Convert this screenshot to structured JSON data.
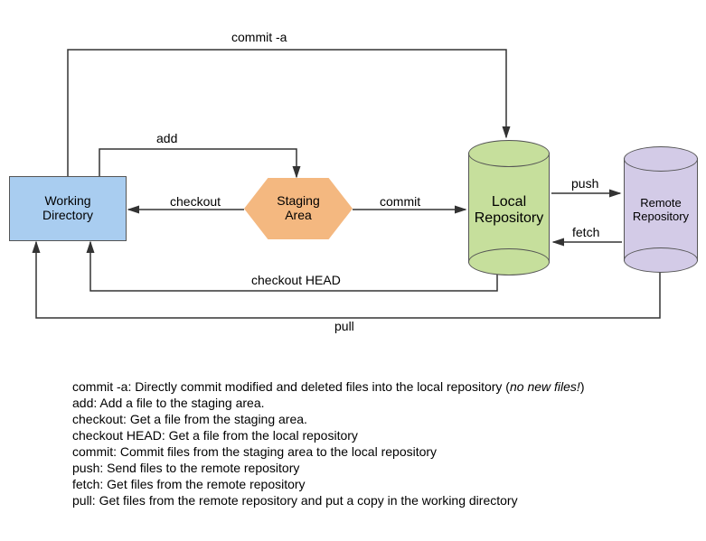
{
  "nodes": {
    "working_directory": "Working\nDirectory",
    "staging_area": "Staging\nArea",
    "local_repo": "Local\nRepository",
    "remote_repo": "Remote\nRepository"
  },
  "edges": {
    "commit_a": "commit -a",
    "add": "add",
    "checkout": "checkout",
    "commit": "commit",
    "checkout_head": "checkout HEAD",
    "push": "push",
    "fetch": "fetch",
    "pull": "pull"
  },
  "descriptions": [
    {
      "cmd": "commit -a",
      "text": "Directly commit modified and deleted files into the local repository (",
      "note": "no new files!",
      "after": ")"
    },
    {
      "cmd": "add",
      "text": "Add a file to the staging area."
    },
    {
      "cmd": "checkout",
      "text": "Get a file from the staging area."
    },
    {
      "cmd": "checkout HEAD",
      "text": "Get a file from the local repository"
    },
    {
      "cmd": "commit",
      "text": "Commit files from the staging area to the local repository"
    },
    {
      "cmd": "push",
      "text": "Send files to the remote repository"
    },
    {
      "cmd": "fetch",
      "text": "Get files from the remote repository"
    },
    {
      "cmd": "pull",
      "text": "Get files from the remote repository and put a copy in the working directory"
    }
  ],
  "colors": {
    "wd": "#a9cdf0",
    "staging": "#f4b880",
    "local": "#c6df9c",
    "remote": "#d3cbe7",
    "stroke": "#333333"
  }
}
